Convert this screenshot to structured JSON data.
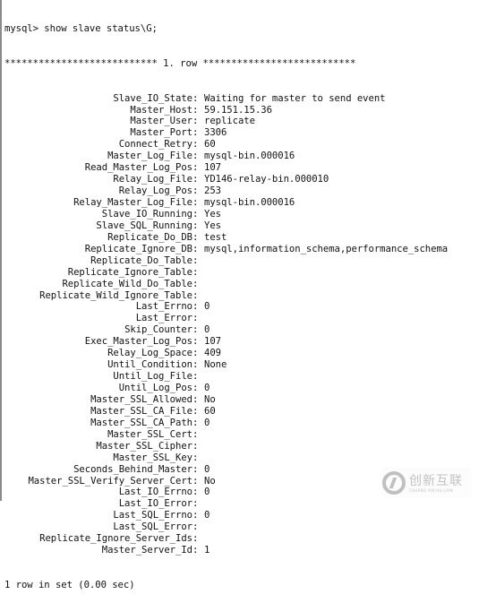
{
  "terminal": {
    "command_line": "mysql> show slave status\\G;",
    "row_header": "*************************** 1. row ***************************",
    "fields": [
      {
        "key": "Slave_IO_State",
        "value": "Waiting for master to send event"
      },
      {
        "key": "Master_Host",
        "value": "59.151.15.36"
      },
      {
        "key": "Master_User",
        "value": "replicate"
      },
      {
        "key": "Master_Port",
        "value": "3306"
      },
      {
        "key": "Connect_Retry",
        "value": "60"
      },
      {
        "key": "Master_Log_File",
        "value": "mysql-bin.000016"
      },
      {
        "key": "Read_Master_Log_Pos",
        "value": "107"
      },
      {
        "key": "Relay_Log_File",
        "value": "YD146-relay-bin.000010"
      },
      {
        "key": "Relay_Log_Pos",
        "value": "253"
      },
      {
        "key": "Relay_Master_Log_File",
        "value": "mysql-bin.000016"
      },
      {
        "key": "Slave_IO_Running",
        "value": "Yes"
      },
      {
        "key": "Slave_SQL_Running",
        "value": "Yes"
      },
      {
        "key": "Replicate_Do_DB",
        "value": "test"
      },
      {
        "key": "Replicate_Ignore_DB",
        "value": "mysql,information_schema,performance_schema"
      },
      {
        "key": "Replicate_Do_Table",
        "value": ""
      },
      {
        "key": "Replicate_Ignore_Table",
        "value": ""
      },
      {
        "key": "Replicate_Wild_Do_Table",
        "value": ""
      },
      {
        "key": "Replicate_Wild_Ignore_Table",
        "value": ""
      },
      {
        "key": "Last_Errno",
        "value": "0"
      },
      {
        "key": "Last_Error",
        "value": ""
      },
      {
        "key": "Skip_Counter",
        "value": "0"
      },
      {
        "key": "Exec_Master_Log_Pos",
        "value": "107"
      },
      {
        "key": "Relay_Log_Space",
        "value": "409"
      },
      {
        "key": "Until_Condition",
        "value": "None"
      },
      {
        "key": "Until_Log_File",
        "value": ""
      },
      {
        "key": "Until_Log_Pos",
        "value": "0"
      },
      {
        "key": "Master_SSL_Allowed",
        "value": "No"
      },
      {
        "key": "Master_SSL_CA_File",
        "value": "60"
      },
      {
        "key": "Master_SSL_CA_Path",
        "value": "0"
      },
      {
        "key": "Master_SSL_Cert",
        "value": ""
      },
      {
        "key": "Master_SSL_Cipher",
        "value": ""
      },
      {
        "key": "Master_SSL_Key",
        "value": ""
      },
      {
        "key": "Seconds_Behind_Master",
        "value": "0"
      },
      {
        "key": "Master_SSL_Verify_Server_Cert",
        "value": "No"
      },
      {
        "key": "Last_IO_Errno",
        "value": "0"
      },
      {
        "key": "Last_IO_Error",
        "value": ""
      },
      {
        "key": "Last_SQL_Errno",
        "value": "0"
      },
      {
        "key": "Last_SQL_Error",
        "value": ""
      },
      {
        "key": "Replicate_Ignore_Server_Ids",
        "value": ""
      },
      {
        "key": "Master_Server_Id",
        "value": "1"
      }
    ],
    "separator": ":",
    "footer": "1 row in set (0.00 sec)"
  },
  "watermark": {
    "icon": "brand-logo-icon",
    "text_cn": "创新互联",
    "text_en": "CHUANG XIN HU LIAN"
  }
}
